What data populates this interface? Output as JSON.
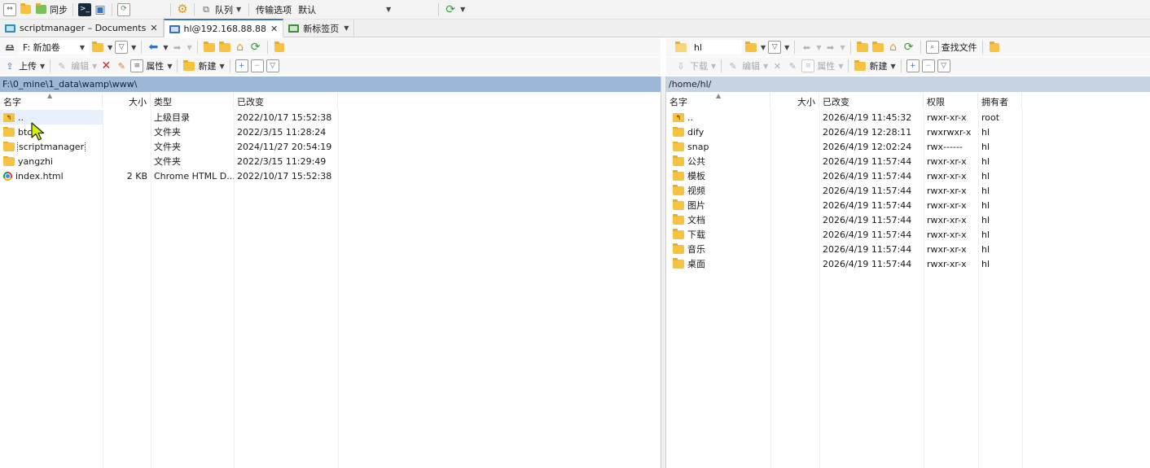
{
  "toolbar": {
    "sync_label": "同步",
    "queue_label": "队列",
    "transfer_options_label": "传输选项",
    "transfer_preset_value": "默认"
  },
  "tabs": [
    {
      "label": "scriptmanager – Documents"
    },
    {
      "label": "hl@192.168.88.88"
    },
    {
      "label": "新标签页"
    }
  ],
  "local": {
    "drive_value": "F: 新加卷",
    "upload_label": "上传",
    "edit_label": "编辑",
    "properties_label": "属性",
    "new_label": "新建",
    "path": "F:\\0_mine\\1_data\\wamp\\www\\",
    "headers": {
      "name": "名字",
      "size": "大小",
      "type": "类型",
      "modified": "已改变"
    },
    "rows": [
      {
        "name": "..",
        "size": "",
        "type": "上级目录",
        "modified": "2022/10/17 15:52:38",
        "icon": "parent-dir-icon"
      },
      {
        "name": "btc",
        "size": "",
        "type": "文件夹",
        "modified": "2022/3/15 11:28:24",
        "icon": "folder-icon"
      },
      {
        "name": "scriptmanager",
        "size": "",
        "type": "文件夹",
        "modified": "2024/11/27 20:54:19",
        "icon": "folder-icon"
      },
      {
        "name": "yangzhi",
        "size": "",
        "type": "文件夹",
        "modified": "2022/3/15 11:29:49",
        "icon": "folder-icon"
      },
      {
        "name": "index.html",
        "size": "2 KB",
        "type": "Chrome HTML D...",
        "modified": "2022/10/17 15:52:38",
        "icon": "chrome-file-icon"
      }
    ]
  },
  "remote": {
    "dir_value": "hl",
    "find_files_label": "查找文件",
    "download_label": "下载",
    "edit_label": "编辑",
    "properties_label": "属性",
    "new_label": "新建",
    "path": "/home/hl/",
    "headers": {
      "name": "名字",
      "size": "大小",
      "modified": "已改变",
      "permissions": "权限",
      "owner": "拥有者"
    },
    "rows": [
      {
        "name": "..",
        "size": "",
        "modified": "2026/4/19 11:45:32",
        "permissions": "rwxr-xr-x",
        "owner": "root",
        "icon": "parent-dir-icon"
      },
      {
        "name": "dify",
        "size": "",
        "modified": "2026/4/19 12:28:11",
        "permissions": "rwxrwxr-x",
        "owner": "hl",
        "icon": "folder-icon"
      },
      {
        "name": "snap",
        "size": "",
        "modified": "2026/4/19 12:02:24",
        "permissions": "rwx------",
        "owner": "hl",
        "icon": "folder-icon"
      },
      {
        "name": "公共",
        "size": "",
        "modified": "2026/4/19 11:57:44",
        "permissions": "rwxr-xr-x",
        "owner": "hl",
        "icon": "folder-icon"
      },
      {
        "name": "模板",
        "size": "",
        "modified": "2026/4/19 11:57:44",
        "permissions": "rwxr-xr-x",
        "owner": "hl",
        "icon": "folder-icon"
      },
      {
        "name": "视频",
        "size": "",
        "modified": "2026/4/19 11:57:44",
        "permissions": "rwxr-xr-x",
        "owner": "hl",
        "icon": "folder-icon"
      },
      {
        "name": "图片",
        "size": "",
        "modified": "2026/4/19 11:57:44",
        "permissions": "rwxr-xr-x",
        "owner": "hl",
        "icon": "folder-icon"
      },
      {
        "name": "文档",
        "size": "",
        "modified": "2026/4/19 11:57:44",
        "permissions": "rwxr-xr-x",
        "owner": "hl",
        "icon": "folder-icon"
      },
      {
        "name": "下载",
        "size": "",
        "modified": "2026/4/19 11:57:44",
        "permissions": "rwxr-xr-x",
        "owner": "hl",
        "icon": "folder-icon"
      },
      {
        "name": "音乐",
        "size": "",
        "modified": "2026/4/19 11:57:44",
        "permissions": "rwxr-xr-x",
        "owner": "hl",
        "icon": "folder-icon"
      },
      {
        "name": "桌面",
        "size": "",
        "modified": "2026/4/19 11:57:44",
        "permissions": "rwxr-xr-x",
        "owner": "hl",
        "icon": "folder-icon"
      }
    ]
  },
  "colors": {
    "active_path_bg": "#9db7d6",
    "inactive_path_bg": "#c7d3e2",
    "folder": "#f5c242",
    "accent": "#3b73c2"
  }
}
